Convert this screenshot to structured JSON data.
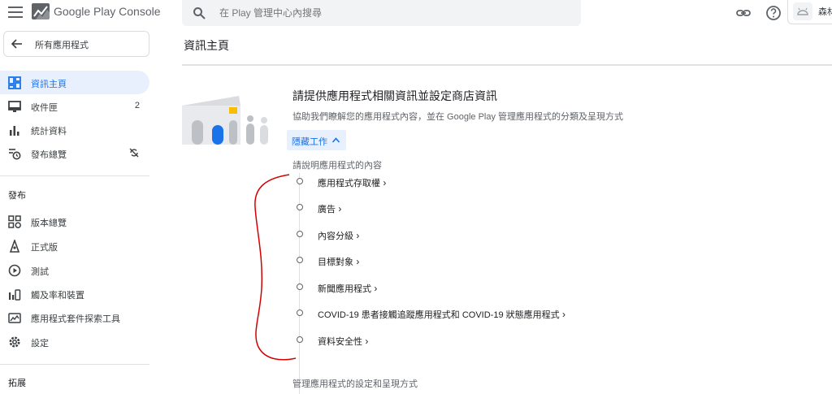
{
  "app": {
    "title": "Google Play Console"
  },
  "search": {
    "placeholder": "在 Play 管理中心內搜尋"
  },
  "account": {
    "name": "森林"
  },
  "sidebar": {
    "back_label": "所有應用程式",
    "items": [
      {
        "label": "資訊主頁",
        "icon": "dashboard-icon",
        "active": true
      },
      {
        "label": "收件匣",
        "icon": "inbox-icon",
        "badge": "2"
      },
      {
        "label": "統計資料",
        "icon": "statistics-icon"
      },
      {
        "label": "發布總覽",
        "icon": "publishing-overview-icon",
        "badge_icon": "sync-off-icon"
      }
    ],
    "release_section": "發布",
    "release_items": [
      {
        "label": "版本總覽",
        "icon": "releases-overview-icon"
      },
      {
        "label": "正式版",
        "icon": "production-icon"
      },
      {
        "label": "測試",
        "icon": "testing-icon"
      },
      {
        "label": "觸及率和裝置",
        "icon": "reach-devices-icon"
      },
      {
        "label": "應用程式套件探索工具",
        "icon": "app-bundle-explorer-icon"
      },
      {
        "label": "設定",
        "icon": "settings-icon"
      }
    ],
    "grow_section": "拓展"
  },
  "main": {
    "title": "資訊主頁",
    "card": {
      "title": "請提供應用程式相關資訊並設定商店資訊",
      "subtitle": "協助我們瞭解您的應用程式內容，並在 Google Play 管理應用程式的分類及呈現方式",
      "hide_button": "隱藏工作",
      "section_heading": "請說明應用程式的內容",
      "tasks": [
        "應用程式存取權",
        "廣告",
        "內容分級",
        "目標對象",
        "新聞應用程式",
        "COVID-19 患者接觸追蹤應用程式和 COVID-19 狀態應用程式",
        "資料安全性"
      ],
      "next_heading": "管理應用程式的設定和呈現方式"
    }
  },
  "colors": {
    "accent": "#1a73e8",
    "active_bg": "#e8f0fe",
    "annotation": "#d50000"
  }
}
